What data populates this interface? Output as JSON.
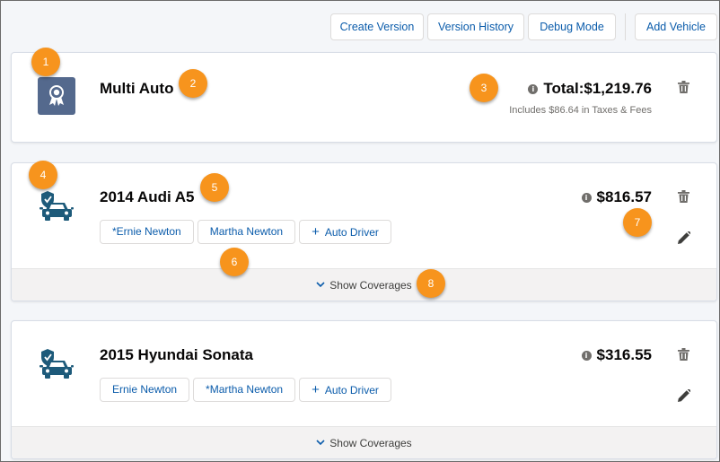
{
  "toolbar": {
    "create_version": "Create Version",
    "version_history": "Version History",
    "debug_mode": "Debug Mode",
    "add_vehicle": "Add Vehicle"
  },
  "summary": {
    "title": "Multi Auto",
    "total": "Total:$1,219.76",
    "taxes_note": "Includes $86.64 in Taxes & Fees"
  },
  "vehicles": [
    {
      "title": "2014 Audi A5",
      "price": "$816.57",
      "drivers": [
        "*Ernie Newton",
        "Martha Newton"
      ],
      "add_driver": "Auto Driver",
      "show_coverages": "Show Coverages"
    },
    {
      "title": "2015 Hyundai Sonata",
      "price": "$316.55",
      "drivers": [
        "Ernie Newton",
        "*Martha Newton"
      ],
      "add_driver": "Auto Driver",
      "show_coverages": "Show Coverages"
    }
  ],
  "callouts": [
    "1",
    "2",
    "3",
    "4",
    "5",
    "6",
    "7",
    "8"
  ],
  "icons": {
    "summary": "award-ribbon-icon",
    "vehicle": "car-shield-icon",
    "info": "info-icon",
    "delete": "trash-icon",
    "edit": "pencil-icon",
    "expand": "chevron-down-icon",
    "add": "plus-icon"
  },
  "colors": {
    "link_blue": "#0b5cab",
    "icon_slate": "#54698d",
    "car_icon": "#1d5a7a",
    "callout_orange": "#f7941d"
  }
}
